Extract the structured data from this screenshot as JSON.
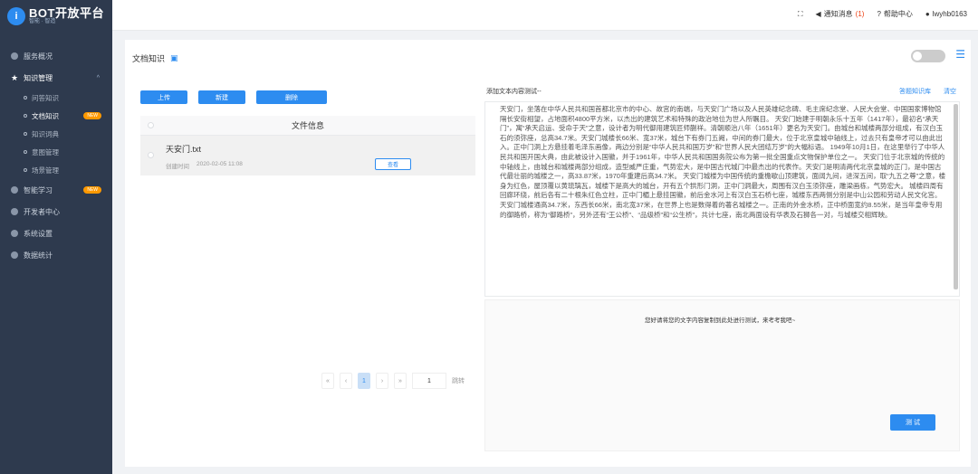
{
  "app": {
    "logo_main": "BOT开放平台",
    "logo_sub": "智能 · 智造",
    "logo_badge": "i"
  },
  "topbar": {
    "notifications_label": "通知消息",
    "notifications_count": "(1)",
    "help_label": "帮助中心",
    "user": "lwyhb0163"
  },
  "sidebar": {
    "items": [
      {
        "label": "服务概况"
      },
      {
        "label": "知识管理"
      },
      {
        "label": "智能学习",
        "badge": "NEW"
      },
      {
        "label": "开发者中心"
      },
      {
        "label": "系统设置"
      },
      {
        "label": "数据统计"
      }
    ],
    "sub_items": [
      {
        "label": "问答知识"
      },
      {
        "label": "文档知识",
        "badge": "NEW"
      },
      {
        "label": "知识词典"
      },
      {
        "label": "意图管理"
      },
      {
        "label": "场景管理"
      }
    ]
  },
  "page": {
    "title": "文档知识",
    "buttons": {
      "upload": "上传",
      "create": "新建",
      "delete": "删除"
    },
    "table_header": "文件信息",
    "file": {
      "name": "天安门.txt",
      "meta_label": "创建时间",
      "date": "2020-02-05 11:08",
      "action": "查看"
    },
    "pager": {
      "prev": "«",
      "prev2": "‹",
      "current": "1",
      "next2": "›",
      "next": "»",
      "goto_value": "1",
      "goto_label": "跳转"
    },
    "right": {
      "label": "添加文本内容测试--",
      "links": [
        "答题知识库",
        "清空"
      ],
      "text": "天安门，坐落在中华人民共和国首都北京市的中心、故宫的南端，与天安门广场以及人民英雄纪念碑、毛主席纪念堂、人民大会堂、中国国家博物馆隔长安街相望，占地面积4800平方米，以杰出的建筑艺术和特殊的政治地位为世人所瞩目。\n天安门始建于明朝永乐十五年（1417年），最初名“承天门”，寓“承天启运、受命于天”之意，设计者为明代御用建筑匠师蒯祥。清朝顺治八年（1651年）更名为天安门。由城台和城楼两部分组成，有汉白玉石的须弥座，总高34.7米。天安门城楼长66米、宽37米，城台下有券门五阙，中间的券门最大，位于北京皇城中轴线上，过去只有皇帝才可以由此出入。正中门洞上方悬挂着毛泽东画像，两边分别是“中华人民共和国万岁”和“世界人民大团结万岁”的大幅标语。\n1949年10月1日，在这里举行了中华人民共和国开国大典，由此被设计入国徽，并于1961年，中华人民共和国国务院公布为第一批全国重点文物保护单位之一。\n天安门位于北京城的传统的中轴线上，由城台和城楼两部分组成，造型威严庄重，气势宏大，是中国古代城门中最杰出的代表作。天安门是明清两代北京皇城的正门，是中国古代最壮丽的城楼之一，高33.87米，1970年重建后高34.7米。\n天安门城楼为中国传统的重檐歇山顶建筑，面阔九间，进深五间，取“九五之尊”之意，楼身为红色，屋顶覆以黄琉璃瓦，城楼下是高大的城台，开有五个拱形门洞，正中门洞最大，周围有汉白玉须弥座，雕梁画栋，气势宏大。\n城楼四周有回廊环绕，前后各有二十根朱红色立柱，正中门楣上悬挂国徽，前后金水河上有汉白玉石桥七座，城楼东西两侧分别是中山公园和劳动人民文化宫。天安门城楼通高34.7米，东西长66米，南北宽37米，在世界上也是数得着的著名城楼之一。正南的外金水桥，正中桥面宽约8.55米，是当年皇帝专用的御路桥，称为“御路桥”，另外还有“王公桥”、“品级桥”和“公生桥”，共计七座，南北两面设有华表及石狮各一对，与城楼交相辉映。"
    },
    "result_tip": "您好请将您的文字内容复制到此处进行测试，来考考我吧~",
    "submit": "测 试"
  }
}
